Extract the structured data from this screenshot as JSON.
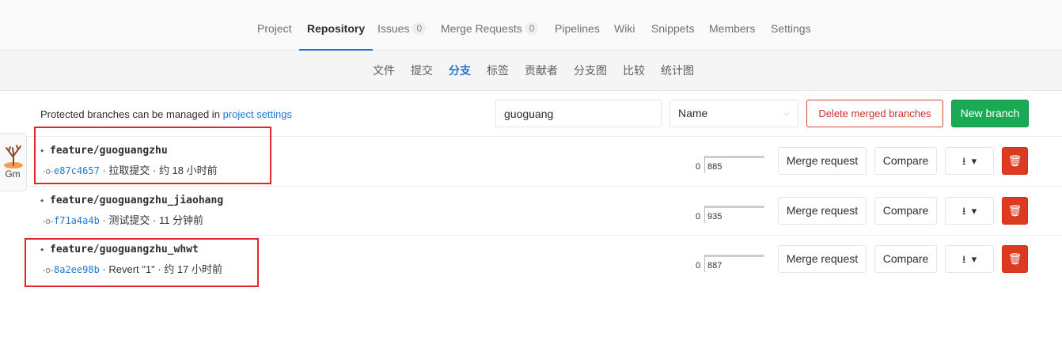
{
  "nav": {
    "project": "Project",
    "repository": "Repository",
    "issues": "Issues",
    "issues_count": "0",
    "merge_requests": "Merge Requests",
    "merge_requests_count": "0",
    "pipelines": "Pipelines",
    "wiki": "Wiki",
    "snippets": "Snippets",
    "members": "Members",
    "settings": "Settings"
  },
  "subnav": {
    "files": "文件",
    "commits": "提交",
    "branches": "分支",
    "tags": "标签",
    "contributors": "贡献者",
    "graph": "分支图",
    "compare": "比较",
    "charts": "统计图"
  },
  "toolbar": {
    "info_prefix": "Protected branches can be managed in",
    "info_link": "project settings",
    "search_value": "guoguang",
    "sort_value": "Name",
    "delete_merged": "Delete merged branches",
    "new_branch": "New branch"
  },
  "side_widget": {
    "label": "Gm"
  },
  "branches": [
    {
      "name": "feature/guoguangzhu",
      "sha": "e87c4657",
      "message": "拉取提交",
      "time": "约 18 小时前",
      "behind": "0",
      "ahead": "885"
    },
    {
      "name": "feature/guoguangzhu_jiaohang",
      "sha": "f71a4a4b",
      "message": "测试提交",
      "time": "11 分钟前",
      "behind": "0",
      "ahead": "935"
    },
    {
      "name": "feature/guoguangzhu_whwt",
      "sha": "8a2ee98b",
      "message": "Revert \"1\"",
      "time": "约 17 小时前",
      "behind": "0",
      "ahead": "887"
    }
  ],
  "row_actions": {
    "merge_request": "Merge request",
    "compare": "Compare",
    "download_icon": "download-icon",
    "delete_icon": "trash-icon"
  },
  "colors": {
    "accent": "#1f78d1",
    "success": "#1aaa55",
    "danger": "#db3b21",
    "highlight": "#e0262b"
  }
}
